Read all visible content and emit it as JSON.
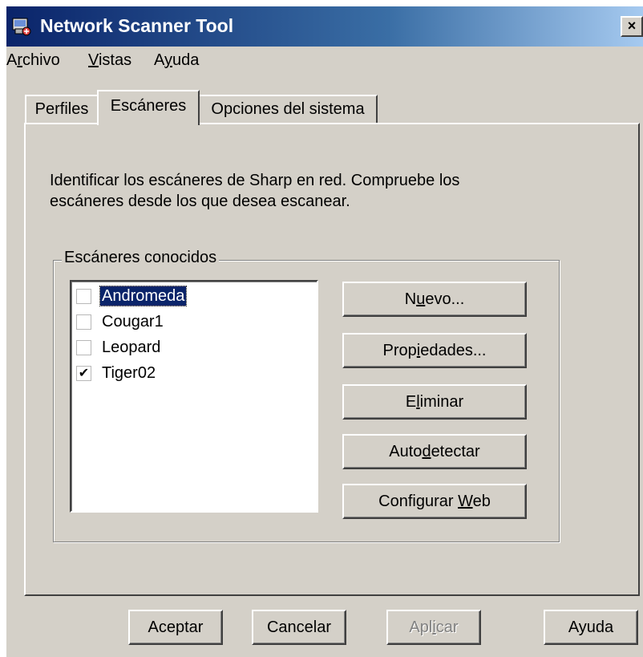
{
  "window": {
    "title": "Network Scanner Tool",
    "close_glyph": "×",
    "app_icon": "scanner-app-icon"
  },
  "menu": {
    "items": [
      {
        "label": "Archivo",
        "hotkey_index": 1
      },
      {
        "label": "Vistas",
        "hotkey_index": 0
      },
      {
        "label": "Ayuda",
        "hotkey_index": 1
      }
    ]
  },
  "tabs": [
    {
      "label": "Perfiles",
      "active": false
    },
    {
      "label": "Escáneres",
      "active": true
    },
    {
      "label": "Opciones del sistema",
      "active": false
    }
  ],
  "panel": {
    "description_line1": "Identificar los escáneres de Sharp en red.  Compruebe los",
    "description_line2": "escáneres desde los que desea  escanear.",
    "group_label": "Escáneres conocidos",
    "scanners": [
      {
        "name": "Andromeda",
        "checked": false,
        "selected": true
      },
      {
        "name": "Cougar1",
        "checked": false,
        "selected": false
      },
      {
        "name": "Leopard",
        "checked": false,
        "selected": false
      },
      {
        "name": "Tiger02",
        "checked": true,
        "selected": false
      }
    ],
    "buttons": {
      "nuevo": "Nuevo...",
      "propiedades": "Propiedades...",
      "eliminar": "Eliminar",
      "autodetectar": "Autodetectar",
      "configurar_web": "Configurar Web"
    }
  },
  "footer": {
    "aceptar": "Aceptar",
    "cancelar": "Cancelar",
    "aplicar": "Aplicar",
    "ayuda": "Ayuda"
  },
  "colors": {
    "title_gradient_start": "#0a246a",
    "title_gradient_end": "#a6caf0",
    "face": "#d4d0c8",
    "selection": "#0a246a"
  }
}
